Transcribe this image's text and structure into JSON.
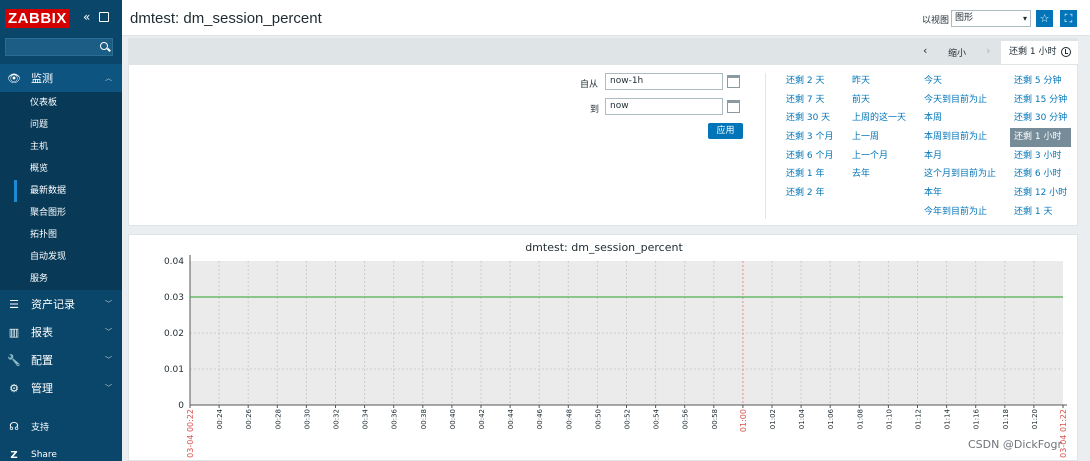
{
  "sidebar": {
    "logo": "ZABBIX",
    "search_value": "",
    "monitor": {
      "label": "监测",
      "icon": "eye-icon"
    },
    "monitor_items": [
      {
        "label": "仪表板"
      },
      {
        "label": "问题"
      },
      {
        "label": "主机"
      },
      {
        "label": "概览"
      },
      {
        "label": "最新数据",
        "active": true
      },
      {
        "label": "聚合图形"
      },
      {
        "label": "拓扑图"
      },
      {
        "label": "自动发现"
      },
      {
        "label": "服务"
      }
    ],
    "inventory": {
      "label": "资产记录",
      "icon": "list-icon"
    },
    "reports": {
      "label": "报表",
      "icon": "bar-chart-icon"
    },
    "config": {
      "label": "配置",
      "icon": "wrench-icon"
    },
    "admin": {
      "label": "管理",
      "icon": "gear-icon"
    },
    "support": {
      "label": "支持",
      "icon": "headset-icon"
    },
    "share": {
      "label": "Share",
      "icon": "share-z-icon"
    }
  },
  "header": {
    "title": "dmtest: dm_session_percent",
    "view_as_label": "以视图",
    "view_as_value": "图形"
  },
  "filter": {
    "prev": "‹",
    "zoom_out": "缩小",
    "next": "›",
    "range_tab": "还剩 1 小时",
    "from_label": "自从",
    "from_value": "now-1h",
    "to_label": "到",
    "to_value": "now",
    "apply": "应用",
    "quick_ranges": [
      [
        "还剩 2 天",
        "还剩 7 天",
        "还剩 30 天",
        "还剩 3 个月",
        "还剩 6 个月",
        "还剩 1 年",
        "还剩 2 年"
      ],
      [
        "昨天",
        "前天",
        "上周的这一天",
        "上一周",
        "上一个月",
        "去年"
      ],
      [
        "今天",
        "今天到目前为止",
        "本周",
        "本周到目前为止",
        "本月",
        "这个月到目前为止",
        "本年",
        "今年到目前为止"
      ],
      [
        "还剩 5 分钟",
        "还剩 15 分钟",
        "还剩 30 分钟",
        "还剩 1 小时",
        "还剩 3 小时",
        "还剩 6 小时",
        "还剩 12 小时",
        "还剩 1 天"
      ]
    ],
    "selected_range": "还剩 1 小时"
  },
  "chart_data": {
    "type": "line",
    "title": "dmtest: dm_session_percent",
    "xlabel": "",
    "ylabel": "",
    "ylim": [
      0,
      0.04
    ],
    "y_ticks": [
      "0.04",
      "0.03",
      "0.02",
      "0.01",
      "0"
    ],
    "x_ticks": [
      "03-04 00:22",
      "00:24",
      "00:26",
      "00:28",
      "00:30",
      "00:32",
      "00:34",
      "00:36",
      "00:38",
      "00:40",
      "00:42",
      "00:44",
      "00:46",
      "00:48",
      "00:50",
      "00:52",
      "00:54",
      "00:56",
      "00:58",
      "01:00",
      "01:02",
      "01:04",
      "01:06",
      "01:08",
      "01:10",
      "01:12",
      "01:14",
      "01:16",
      "01:18",
      "01:20",
      "03-04 01:22"
    ],
    "highlight_ticks": [
      "03-04 00:22",
      "01:00",
      "03-04 01:22"
    ],
    "series": [
      {
        "values": [
          0.03,
          0.03
        ],
        "color": "#4caf50"
      }
    ],
    "colors": {
      "plot_bg": "#ebebeb",
      "grid": "#cccccc",
      "highlight": "#d9534f",
      "axis": "#555555"
    }
  },
  "watermark": "CSDN @DickFogr"
}
